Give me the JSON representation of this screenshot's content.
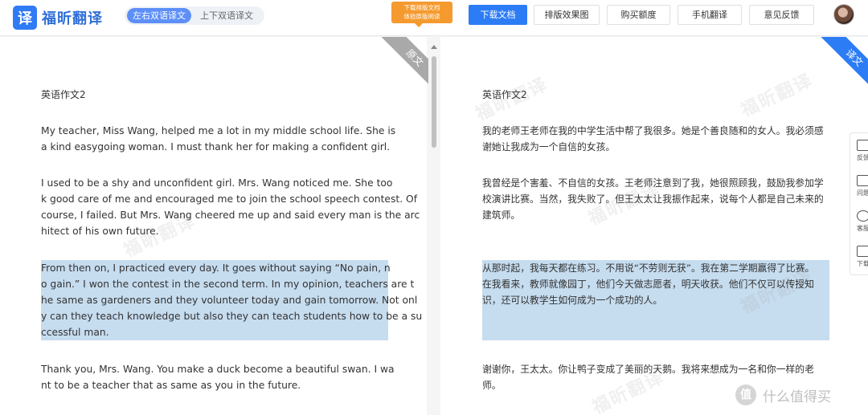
{
  "app": {
    "logo_glyph": "译",
    "name": "福昕翻译"
  },
  "mode_toggle": {
    "side_by_side": "左右双语译文",
    "top_bottom": "上下双语译文"
  },
  "promo": {
    "line1": "下载排版文档",
    "line2": "体验原版阅读"
  },
  "nav": {
    "download": "下载文档",
    "layout_preview": "排版效果图",
    "buy_quota": "购买额度",
    "mobile_translate": "手机翻译",
    "feedback": "意见反馈"
  },
  "left_panel": {
    "corner_label": "原文",
    "title": "英语作文2",
    "paragraphs": [
      [
        "      My teacher, Miss Wang, helped me a lot in my middle school life. She is",
        "a kind easygoing woman. I must thank her for making a confident girl."
      ],
      [
        "      I used to be a shy and unconfident girl. Mrs. Wang noticed me. She too",
        "k good care of me and encouraged me to join the school speech contest. Of",
        "course, I failed. But Mrs. Wang cheered me up and said every man is the arc",
        "hitect of his own future."
      ],
      [
        "      From then on, I practiced every day. It goes without saying  “No pain, n",
        "o gain.”  I won the contest in the second term. In my opinion, teachers are t",
        "he same as gardeners and they volunteer today and gain tomorrow. Not onl",
        "y can they teach knowledge but also they can teach students how to be a su",
        "ccessful man."
      ],
      [
        "      Thank you, Mrs. Wang. You make a duck become a beautiful swan. I wa",
        "nt to be a teacher that as same as you in the future."
      ]
    ]
  },
  "right_panel": {
    "corner_label": "译文",
    "title": "英语作文2",
    "paragraphs": [
      [
        "我的老师王老师在我的中学生活中帮了我很多。她是个善良随和的女人。我必须感",
        "谢她让我成为一个自信的女孩。"
      ],
      [
        "我曾经是个害羞、不自信的女孩。王老师注意到了我，她很照顾我，鼓励我参加学",
        "校演讲比赛。当然，我失败了。但王太太让我振作起来，说每个人都是自己未来的",
        "建筑师。"
      ],
      [
        "从那时起，我每天都在练习。不用说“不劳则无获”。我在第二学期赢得了比赛。",
        "在我看来，教师就像园丁，他们今天做志愿者，明天收获。他们不仅可以传授知",
        "识，还可以教学生如何成为一个成功的人。"
      ],
      [
        "谢谢你，王太太。你让鸭子变成了美丽的天鹅。我将来想成为一名和你一样的老",
        "师。"
      ]
    ]
  },
  "watermark_text": "福昕翻译",
  "side_rail": [
    "反馈",
    "问题",
    "客服",
    "下载"
  ],
  "site_brand": {
    "badge": "值",
    "text": "什么值得买"
  }
}
